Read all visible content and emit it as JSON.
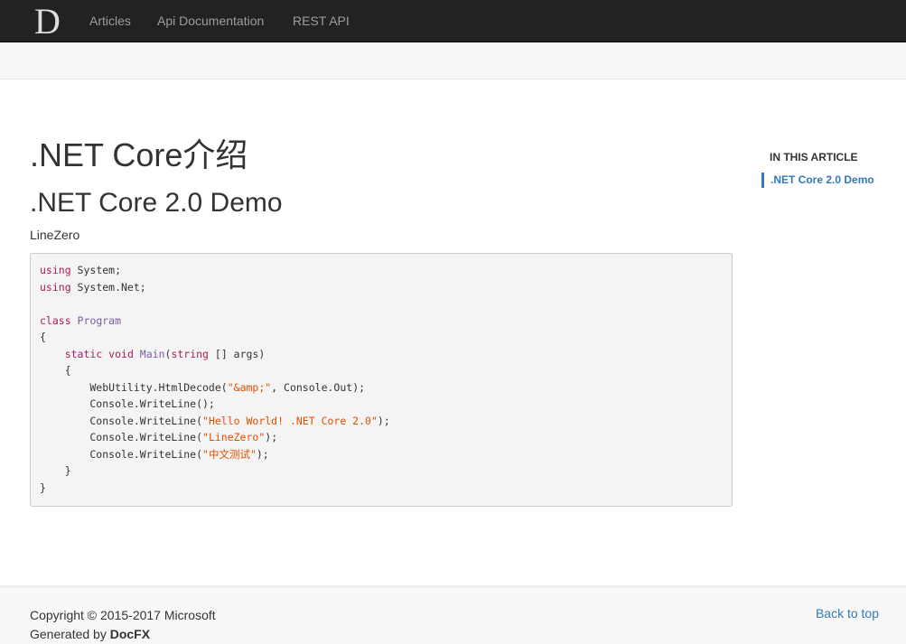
{
  "navbar": {
    "logo_text": "D",
    "links": [
      "Articles",
      "Api Documentation",
      "REST API"
    ]
  },
  "article": {
    "title": ".NET Core介绍",
    "heading": ".NET Core 2.0 Demo",
    "author": "LineZero"
  },
  "code": [
    [
      [
        "kw",
        "using"
      ],
      [
        "",
        "System;"
      ]
    ],
    [
      [
        "kw",
        "using"
      ],
      [
        "",
        "System.Net;"
      ]
    ],
    [],
    [
      [
        "kw",
        "class"
      ],
      [
        "ty",
        "Program"
      ]
    ],
    [
      [
        "",
        "{"
      ]
    ],
    [
      [
        "",
        "    "
      ],
      [
        "kw",
        "static void"
      ],
      [
        "ty",
        "Main"
      ],
      [
        "",
        "("
      ],
      [
        "kw",
        "string"
      ],
      [
        "",
        "[] args)"
      ]
    ],
    [
      [
        "",
        "    {"
      ]
    ],
    [
      [
        "",
        "        WebUtility.HtmlDecode("
      ],
      [
        "st",
        "\"&amp;\""
      ],
      [
        "",
        ", Console.Out);"
      ]
    ],
    [
      [
        "",
        "        Console.WriteLine();"
      ]
    ],
    [
      [
        "",
        "        Console.WriteLine("
      ],
      [
        "st",
        "\"Hello World! .NET Core 2.0\""
      ],
      [
        "",
        ");"
      ]
    ],
    [
      [
        "",
        "        Console.WriteLine("
      ],
      [
        "st",
        "\"LineZero\""
      ],
      [
        "",
        ");"
      ]
    ],
    [
      [
        "",
        "        Console.WriteLine("
      ],
      [
        "st",
        "\"中文测试\""
      ],
      [
        "",
        ");"
      ]
    ],
    [
      [
        "",
        "    }"
      ]
    ],
    [
      [
        "",
        "}"
      ]
    ]
  ],
  "toc": {
    "title": "IN THIS ARTICLE",
    "items": [
      ".NET Core 2.0 Demo"
    ]
  },
  "footer": {
    "copyright": "Copyright © 2015-2017 Microsoft",
    "generated_by": "Generated by ",
    "generator": "DocFX",
    "back_to_top": "Back to top"
  }
}
